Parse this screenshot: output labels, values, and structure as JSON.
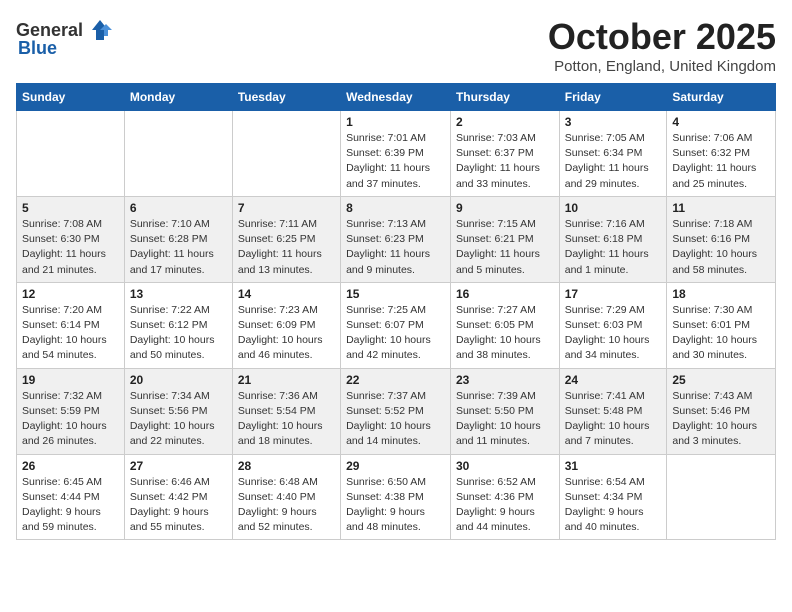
{
  "header": {
    "logo_general": "General",
    "logo_blue": "Blue",
    "month_title": "October 2025",
    "location": "Potton, England, United Kingdom"
  },
  "weekdays": [
    "Sunday",
    "Monday",
    "Tuesday",
    "Wednesday",
    "Thursday",
    "Friday",
    "Saturday"
  ],
  "weeks": [
    [
      {
        "day": "",
        "info": ""
      },
      {
        "day": "",
        "info": ""
      },
      {
        "day": "",
        "info": ""
      },
      {
        "day": "1",
        "info": "Sunrise: 7:01 AM\nSunset: 6:39 PM\nDaylight: 11 hours\nand 37 minutes."
      },
      {
        "day": "2",
        "info": "Sunrise: 7:03 AM\nSunset: 6:37 PM\nDaylight: 11 hours\nand 33 minutes."
      },
      {
        "day": "3",
        "info": "Sunrise: 7:05 AM\nSunset: 6:34 PM\nDaylight: 11 hours\nand 29 minutes."
      },
      {
        "day": "4",
        "info": "Sunrise: 7:06 AM\nSunset: 6:32 PM\nDaylight: 11 hours\nand 25 minutes."
      }
    ],
    [
      {
        "day": "5",
        "info": "Sunrise: 7:08 AM\nSunset: 6:30 PM\nDaylight: 11 hours\nand 21 minutes."
      },
      {
        "day": "6",
        "info": "Sunrise: 7:10 AM\nSunset: 6:28 PM\nDaylight: 11 hours\nand 17 minutes."
      },
      {
        "day": "7",
        "info": "Sunrise: 7:11 AM\nSunset: 6:25 PM\nDaylight: 11 hours\nand 13 minutes."
      },
      {
        "day": "8",
        "info": "Sunrise: 7:13 AM\nSunset: 6:23 PM\nDaylight: 11 hours\nand 9 minutes."
      },
      {
        "day": "9",
        "info": "Sunrise: 7:15 AM\nSunset: 6:21 PM\nDaylight: 11 hours\nand 5 minutes."
      },
      {
        "day": "10",
        "info": "Sunrise: 7:16 AM\nSunset: 6:18 PM\nDaylight: 11 hours\nand 1 minute."
      },
      {
        "day": "11",
        "info": "Sunrise: 7:18 AM\nSunset: 6:16 PM\nDaylight: 10 hours\nand 58 minutes."
      }
    ],
    [
      {
        "day": "12",
        "info": "Sunrise: 7:20 AM\nSunset: 6:14 PM\nDaylight: 10 hours\nand 54 minutes."
      },
      {
        "day": "13",
        "info": "Sunrise: 7:22 AM\nSunset: 6:12 PM\nDaylight: 10 hours\nand 50 minutes."
      },
      {
        "day": "14",
        "info": "Sunrise: 7:23 AM\nSunset: 6:09 PM\nDaylight: 10 hours\nand 46 minutes."
      },
      {
        "day": "15",
        "info": "Sunrise: 7:25 AM\nSunset: 6:07 PM\nDaylight: 10 hours\nand 42 minutes."
      },
      {
        "day": "16",
        "info": "Sunrise: 7:27 AM\nSunset: 6:05 PM\nDaylight: 10 hours\nand 38 minutes."
      },
      {
        "day": "17",
        "info": "Sunrise: 7:29 AM\nSunset: 6:03 PM\nDaylight: 10 hours\nand 34 minutes."
      },
      {
        "day": "18",
        "info": "Sunrise: 7:30 AM\nSunset: 6:01 PM\nDaylight: 10 hours\nand 30 minutes."
      }
    ],
    [
      {
        "day": "19",
        "info": "Sunrise: 7:32 AM\nSunset: 5:59 PM\nDaylight: 10 hours\nand 26 minutes."
      },
      {
        "day": "20",
        "info": "Sunrise: 7:34 AM\nSunset: 5:56 PM\nDaylight: 10 hours\nand 22 minutes."
      },
      {
        "day": "21",
        "info": "Sunrise: 7:36 AM\nSunset: 5:54 PM\nDaylight: 10 hours\nand 18 minutes."
      },
      {
        "day": "22",
        "info": "Sunrise: 7:37 AM\nSunset: 5:52 PM\nDaylight: 10 hours\nand 14 minutes."
      },
      {
        "day": "23",
        "info": "Sunrise: 7:39 AM\nSunset: 5:50 PM\nDaylight: 10 hours\nand 11 minutes."
      },
      {
        "day": "24",
        "info": "Sunrise: 7:41 AM\nSunset: 5:48 PM\nDaylight: 10 hours\nand 7 minutes."
      },
      {
        "day": "25",
        "info": "Sunrise: 7:43 AM\nSunset: 5:46 PM\nDaylight: 10 hours\nand 3 minutes."
      }
    ],
    [
      {
        "day": "26",
        "info": "Sunrise: 6:45 AM\nSunset: 4:44 PM\nDaylight: 9 hours\nand 59 minutes."
      },
      {
        "day": "27",
        "info": "Sunrise: 6:46 AM\nSunset: 4:42 PM\nDaylight: 9 hours\nand 55 minutes."
      },
      {
        "day": "28",
        "info": "Sunrise: 6:48 AM\nSunset: 4:40 PM\nDaylight: 9 hours\nand 52 minutes."
      },
      {
        "day": "29",
        "info": "Sunrise: 6:50 AM\nSunset: 4:38 PM\nDaylight: 9 hours\nand 48 minutes."
      },
      {
        "day": "30",
        "info": "Sunrise: 6:52 AM\nSunset: 4:36 PM\nDaylight: 9 hours\nand 44 minutes."
      },
      {
        "day": "31",
        "info": "Sunrise: 6:54 AM\nSunset: 4:34 PM\nDaylight: 9 hours\nand 40 minutes."
      },
      {
        "day": "",
        "info": ""
      }
    ]
  ]
}
